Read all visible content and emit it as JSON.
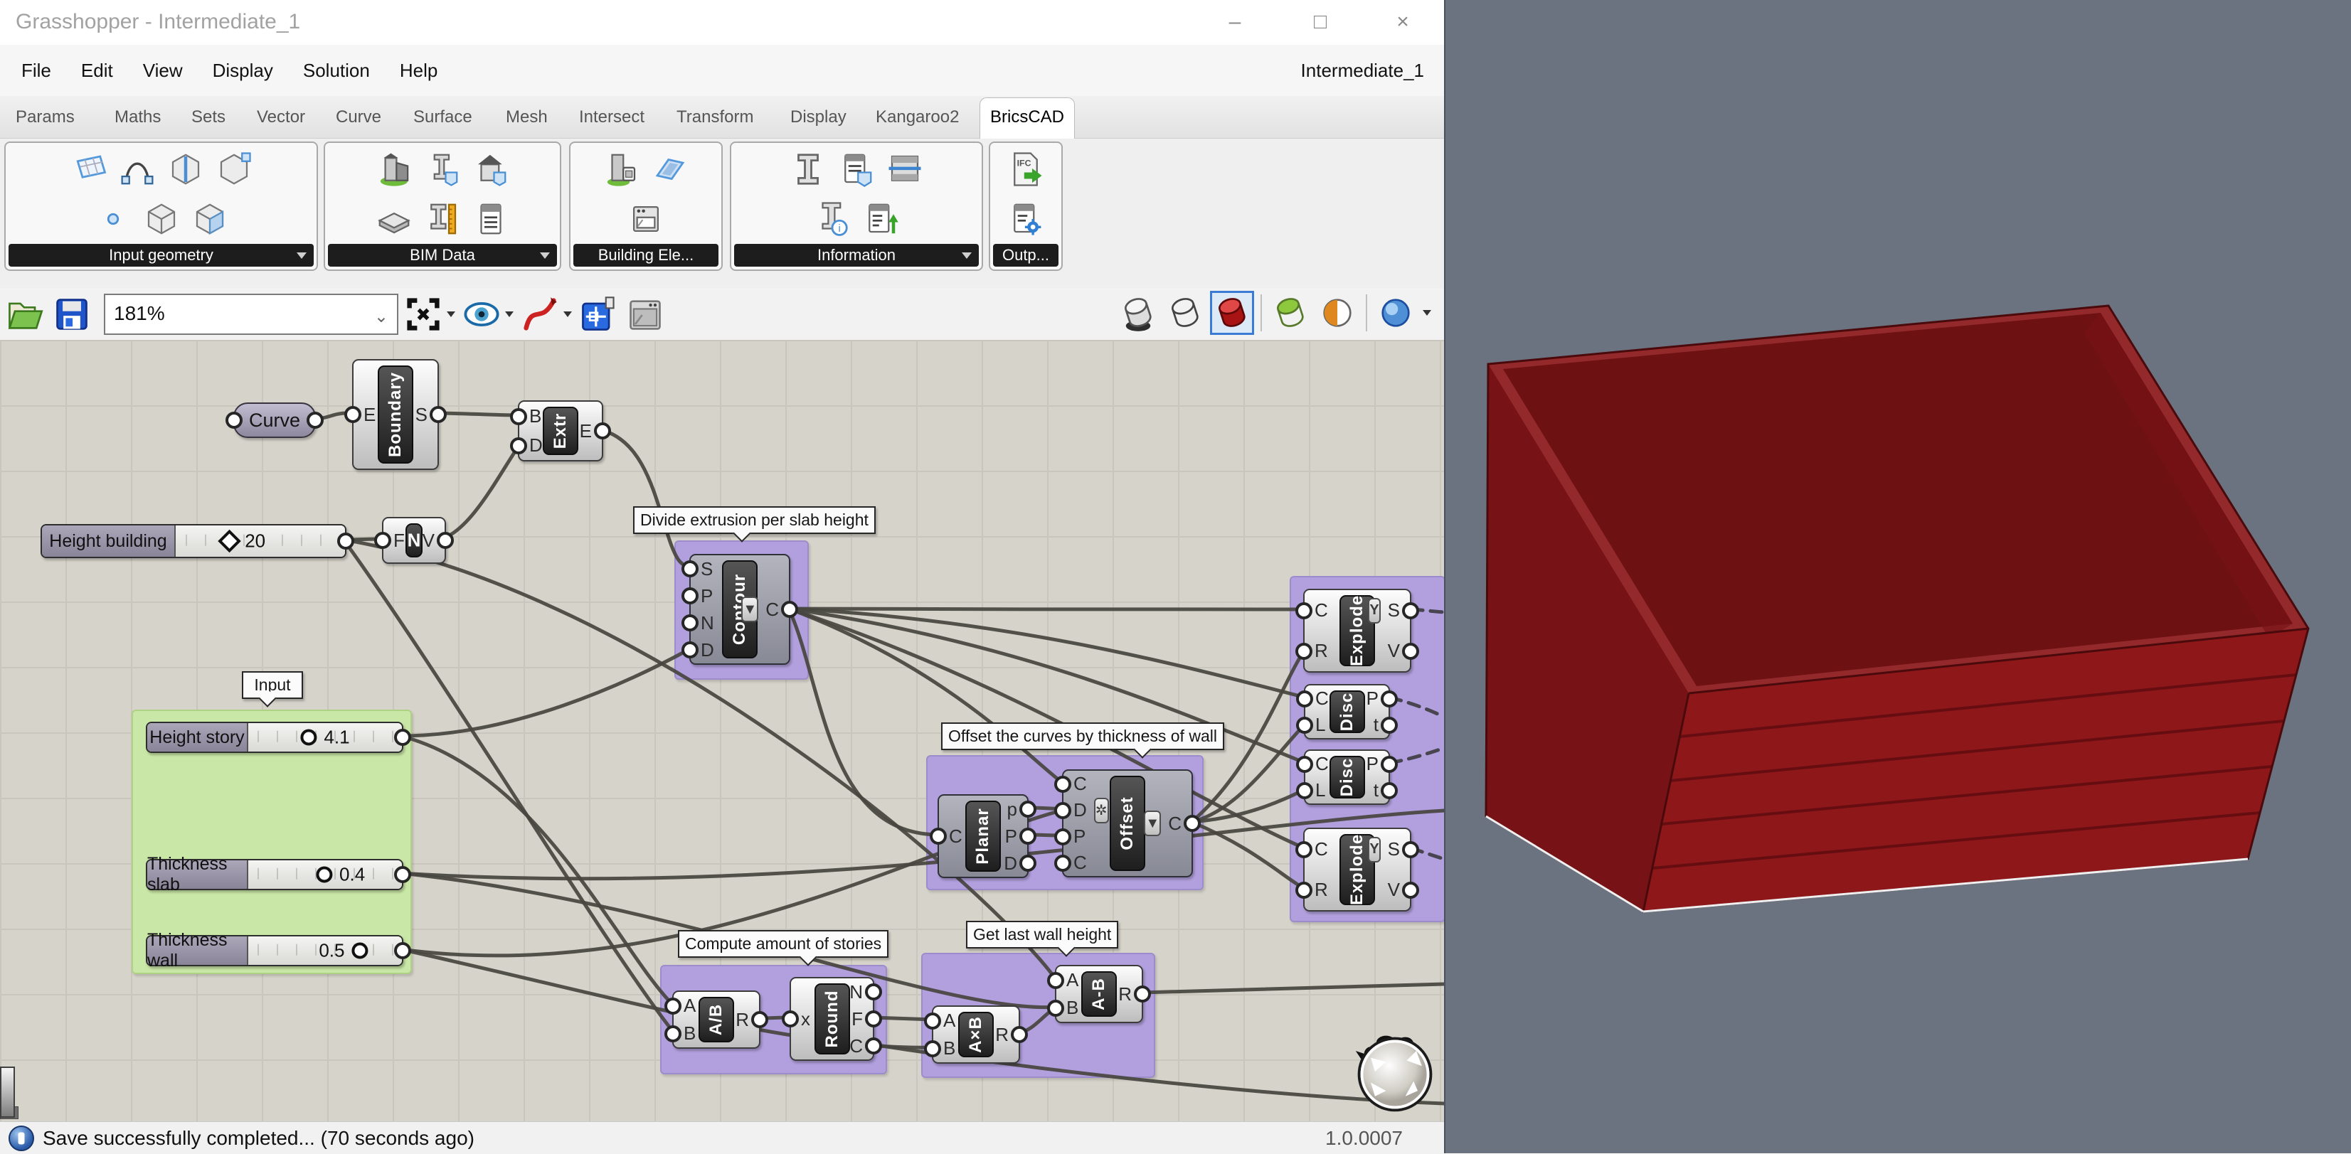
{
  "window": {
    "title": "Grasshopper - Intermediate_1",
    "minimize": "–",
    "maximize": "□",
    "close": "×"
  },
  "menubar": {
    "items": [
      "File",
      "Edit",
      "View",
      "Display",
      "Solution",
      "Help"
    ],
    "right_label": "Intermediate_1"
  },
  "tabs": {
    "items": [
      "Params",
      "Maths",
      "Sets",
      "Vector",
      "Curve",
      "Surface",
      "Mesh",
      "Intersect",
      "Transform",
      "Display",
      "Kangaroo2",
      "BricsCAD"
    ],
    "active_index": 11
  },
  "ribbon": {
    "ifc_label": "IFC",
    "groups": [
      {
        "label": "Input geometry",
        "has_arrow": true,
        "rows": [
          [
            "surface-icon",
            "curve-icon",
            "box-edge-icon",
            "box-corner-icon"
          ],
          [
            "point-icon",
            "box-solid-icon",
            "box-face-icon"
          ]
        ]
      },
      {
        "label": "BIM Data",
        "has_arrow": true,
        "rows": [
          [
            "building-site-icon",
            "beam-tag-icon",
            "house-tag-icon"
          ],
          [
            "slab-icon",
            "beam-ruler-icon",
            "schedule-icon"
          ]
        ]
      },
      {
        "label": "Building Ele...",
        "has_arrow": false,
        "rows": [
          [
            "building-unit-icon",
            "plane-icon"
          ],
          [
            "appliance-icon"
          ]
        ]
      },
      {
        "label": "Information",
        "has_arrow": true,
        "rows": [
          [
            "beam-icon",
            "doc-tag-icon",
            "section-icon"
          ],
          [
            "beam-info-icon",
            "doc-export-icon"
          ]
        ]
      },
      {
        "label": "Outp...",
        "has_arrow": false,
        "rows": [
          [
            "ifc-export-icon"
          ],
          [
            "doc-gear-icon"
          ]
        ]
      }
    ]
  },
  "canvas_toolbar": {
    "zoom_value": "181%",
    "file_icons": [
      "open-folder-icon",
      "save-floppy-icon"
    ],
    "tool_icons": [
      "zoom-extents-icon",
      "preview-eye-icon",
      "sketch-pen-icon",
      "canvas-grid-icon",
      "viewport-frame-icon"
    ],
    "display_modes": [
      "shaded-dark-icon",
      "wireframe-icon",
      "shaded-red-icon",
      "green-preview-icon",
      "half-shade-icon",
      "blue-mesh-icon"
    ],
    "selected_mode_index": 2
  },
  "canvas": {
    "group_labels": [
      "Divide extrusion per slab height",
      "Input",
      "Offset the curves by thickness of wall",
      "Compute amount of stories",
      "Get last wall height"
    ],
    "params": [
      {
        "id": "curve",
        "label": "Curve"
      }
    ],
    "sliders": [
      {
        "id": "height-building",
        "label": "Height building",
        "value": "20"
      },
      {
        "id": "height-story",
        "label": "Height story",
        "value": "4.1"
      },
      {
        "id": "thickness-slab",
        "label": "Thickness slab",
        "value": "0.4"
      },
      {
        "id": "thickness-wall",
        "label": "Thickness wall",
        "value": "0.5"
      }
    ],
    "nodes": [
      {
        "id": "boundary",
        "label": "Boundary",
        "inputs": [
          "E"
        ],
        "outputs": [
          "S"
        ]
      },
      {
        "id": "extr",
        "label": "Extr",
        "inputs": [
          "B",
          "D"
        ],
        "outputs": [
          "E"
        ]
      },
      {
        "id": "n-node",
        "label": "N",
        "inputs": [
          "F"
        ],
        "outputs": [
          "V"
        ]
      },
      {
        "id": "contour",
        "label": "Contour",
        "inputs": [
          "S",
          "P",
          "N",
          "D"
        ],
        "outputs": [
          "C"
        ],
        "out_buttons": {
          "0": "arrow"
        }
      },
      {
        "id": "planar",
        "label": "Planar",
        "inputs": [
          "C"
        ],
        "outputs": [
          "p",
          "P",
          "D"
        ]
      },
      {
        "id": "offset",
        "label": "Offset",
        "inputs": [
          "C",
          "D",
          "P",
          "C"
        ],
        "outputs": [
          "C"
        ],
        "out_buttons": {
          "0": "arrow"
        },
        "in_buttons": {
          "1": "star"
        }
      },
      {
        "id": "explode-1",
        "label": "Explode",
        "inputs": [
          "C",
          "R"
        ],
        "outputs": [
          "S",
          "V"
        ],
        "out_buttons": {
          "0": "graft"
        }
      },
      {
        "id": "disc-1",
        "label": "Disc",
        "inputs": [
          "C",
          "L"
        ],
        "outputs": [
          "P",
          "t"
        ]
      },
      {
        "id": "disc-2",
        "label": "Disc",
        "inputs": [
          "C",
          "L"
        ],
        "outputs": [
          "P",
          "t"
        ]
      },
      {
        "id": "explode-2",
        "label": "Explode",
        "inputs": [
          "C",
          "R"
        ],
        "outputs": [
          "S",
          "V"
        ],
        "out_buttons": {
          "0": "graft"
        }
      },
      {
        "id": "a-div-b",
        "label": "A/B",
        "inputs": [
          "A",
          "B"
        ],
        "outputs": [
          "R"
        ]
      },
      {
        "id": "round",
        "label": "Round",
        "inputs": [
          "x"
        ],
        "outputs": [
          "N",
          "F",
          "C"
        ]
      },
      {
        "id": "a-mul-b",
        "label": "A×B",
        "inputs": [
          "A",
          "B"
        ],
        "outputs": [
          "R"
        ]
      },
      {
        "id": "a-sub-b",
        "label": "A-B",
        "inputs": [
          "A",
          "B"
        ],
        "outputs": [
          "R"
        ]
      }
    ]
  },
  "statusbar": {
    "message": "Save successfully completed... (70 seconds ago)",
    "version": "1.0.0007"
  },
  "viewport": {
    "background": "#6b7380",
    "object": "translucent red box building with story slabs, open top",
    "colors": {
      "face_right": "#8e181b",
      "face_left": "#771316",
      "top_interior": "#6e1113",
      "rim": "#94292c",
      "slab_line": "#5e0c0f",
      "edge": "#4a0a0c",
      "ground_line": "#f0f0f0"
    }
  }
}
